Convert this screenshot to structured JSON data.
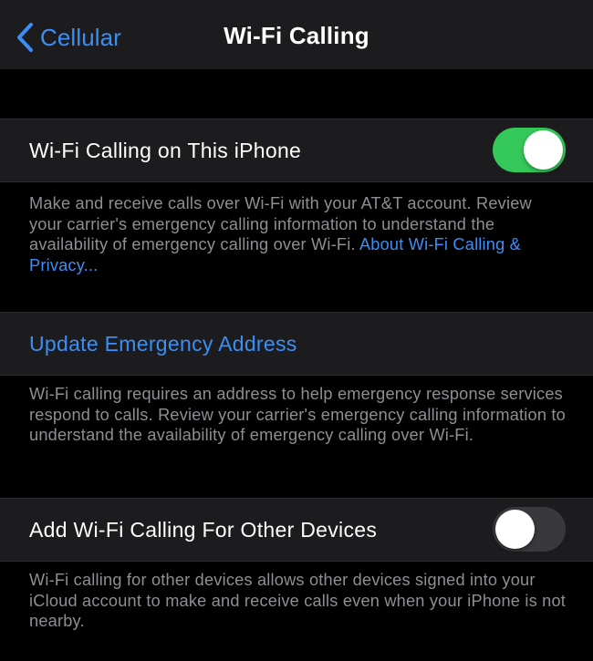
{
  "navbar": {
    "back_label": "Cellular",
    "title": "Wi-Fi Calling"
  },
  "wifi_calling": {
    "label": "Wi-Fi Calling on This iPhone",
    "enabled": true,
    "footer_text": "Make and receive calls over Wi-Fi with your AT&T account. Review your carrier's emergency calling information to understand the availability of emergency calling over Wi-Fi. ",
    "footer_link": "About Wi-Fi Calling & Privacy..."
  },
  "emergency_address": {
    "label": "Update Emergency Address",
    "footer_text": "Wi-Fi calling requires an address to help emergency response services respond to calls. Review your carrier's emergency calling information to understand the availability of emergency calling over Wi-Fi."
  },
  "other_devices": {
    "label": "Add Wi-Fi Calling For Other Devices",
    "enabled": false,
    "footer_text": "Wi-Fi calling for other devices allows other devices signed into your iCloud account to make and receive calls even when your iPhone is not nearby."
  },
  "colors": {
    "accent": "#3b8ef5",
    "toggle_on": "#34c759",
    "toggle_off": "#39393d",
    "background": "#000000",
    "cell_background": "#1c1c1e",
    "secondary_text": "#8e8e93"
  },
  "icons": {
    "back": "chevron-left-icon"
  }
}
